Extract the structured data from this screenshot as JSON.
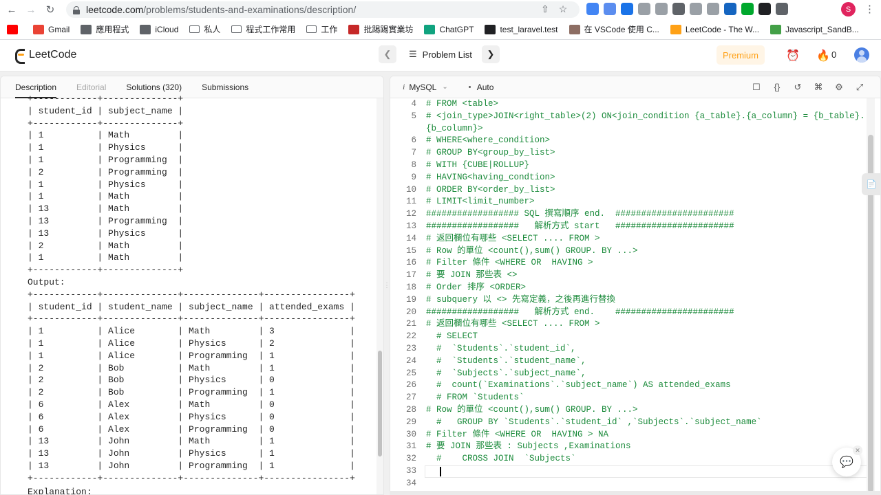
{
  "browser": {
    "url_host": "leetcode.com",
    "url_path": "/problems/students-and-examinations/description/",
    "profile_initial": "S",
    "extensions": [
      {
        "name": "extension-1",
        "color": "#4285f4"
      },
      {
        "name": "extension-2",
        "color": "#5b8def"
      },
      {
        "name": "translate",
        "color": "#1a73e8"
      },
      {
        "name": "extension-4",
        "color": "#9aa0a6"
      },
      {
        "name": "extension-5",
        "color": "#9aa0a6"
      },
      {
        "name": "extension-6",
        "color": "#5f6368"
      },
      {
        "name": "extension-7",
        "color": "#9aa0a6"
      },
      {
        "name": "extension-8",
        "color": "#9aa0a6"
      },
      {
        "name": "extension-9",
        "color": "#1565c0"
      },
      {
        "name": "evernote",
        "color": "#00a82d"
      },
      {
        "name": "chatgpt-ext",
        "color": "#202124"
      },
      {
        "name": "puzzle",
        "color": "#5f6368"
      }
    ],
    "bookmarks": [
      {
        "label": "",
        "icon": "youtube-icon",
        "color": "#ff0000"
      },
      {
        "label": "Gmail",
        "icon": "gmail-icon",
        "color": "#ea4335"
      },
      {
        "label": "應用程式",
        "icon": "apps-grid-icon",
        "color": "#5f6368"
      },
      {
        "label": "iCloud",
        "icon": "apple-icon",
        "color": "#5f6368"
      },
      {
        "label": "私人",
        "icon": "folder-icon",
        "color": ""
      },
      {
        "label": "程式工作常用",
        "icon": "folder-icon",
        "color": ""
      },
      {
        "label": "工作",
        "icon": "folder-icon",
        "color": ""
      },
      {
        "label": "批踢踢實業坊",
        "icon": "ptt-icon",
        "color": "#c62828"
      },
      {
        "label": "ChatGPT",
        "icon": "chatgpt-icon",
        "color": "#10a37f"
      },
      {
        "label": "test_laravel.test",
        "icon": "globe-icon",
        "color": "#202124"
      },
      {
        "label": "在 VSCode 使用 C...",
        "icon": "image-icon",
        "color": "#8d6e63"
      },
      {
        "label": "LeetCode - The W...",
        "icon": "leetcode-icon",
        "color": "#ffa116"
      },
      {
        "label": "Javascript_SandB...",
        "icon": "sandbox-icon",
        "color": "#43a047"
      }
    ]
  },
  "header": {
    "logo_text": "LeetCode",
    "problem_list_label": "Problem List",
    "premium_label": "Premium",
    "streak_count": "0"
  },
  "left_tabs": [
    {
      "label": "Description",
      "state": "active"
    },
    {
      "label": "Editorial",
      "state": "disabled"
    },
    {
      "label": "Solutions (320)",
      "state": "normal"
    },
    {
      "label": "Submissions",
      "state": "normal"
    }
  ],
  "description": {
    "examinations_table_lines": [
      "+------------+--------------+",
      "| student_id | subject_name |",
      "+------------+--------------+",
      "| 1          | Math         |",
      "| 1          | Physics      |",
      "| 1          | Programming  |",
      "| 2          | Programming  |",
      "| 1          | Physics      |",
      "| 1          | Math         |",
      "| 13         | Math         |",
      "| 13         | Programming  |",
      "| 13         | Physics      |",
      "| 2          | Math         |",
      "| 1          | Math         |",
      "+------------+--------------+"
    ],
    "output_label": "Output:",
    "output_table_lines": [
      "+------------+--------------+--------------+----------------+",
      "| student_id | student_name | subject_name | attended_exams |",
      "+------------+--------------+--------------+----------------+",
      "| 1          | Alice        | Math         | 3              |",
      "| 1          | Alice        | Physics      | 2              |",
      "| 1          | Alice        | Programming  | 1              |",
      "| 2          | Bob          | Math         | 1              |",
      "| 2          | Bob          | Physics      | 0              |",
      "| 2          | Bob          | Programming  | 1              |",
      "| 6          | Alex         | Math         | 0              |",
      "| 6          | Alex         | Physics      | 0              |",
      "| 6          | Alex         | Programming  | 0              |",
      "| 13         | John         | Math         | 1              |",
      "| 13         | John         | Physics      | 1              |",
      "| 13         | John         | Programming  | 1              |",
      "+------------+--------------+--------------+----------------+"
    ],
    "explanation_label": "Explanation:"
  },
  "editor": {
    "language": "MySQL",
    "mode": "Auto",
    "current_line": 33,
    "lines": [
      {
        "n": 4,
        "text": "# FROM <table>"
      },
      {
        "n": 5,
        "text": "# <join_type>JOIN<right_table>(2) ON<join_condition {a_table}.{a_column} = {b_table}."
      },
      {
        "n": "",
        "text": "{b_column}>"
      },
      {
        "n": 6,
        "text": "# WHERE<where_condition>"
      },
      {
        "n": 7,
        "text": "# GROUP BY<group_by_list>"
      },
      {
        "n": 8,
        "text": "# WITH {CUBE|ROLLUP}"
      },
      {
        "n": 9,
        "text": "# HAVING<having_condtion>"
      },
      {
        "n": 10,
        "text": "# ORDER BY<order_by_list>"
      },
      {
        "n": 11,
        "text": "# LIMIT<limit_number>"
      },
      {
        "n": 12,
        "text": "################## SQL 撰寫順序 end.  #######################"
      },
      {
        "n": 13,
        "text": "##################   解析方式 start   #######################"
      },
      {
        "n": 14,
        "text": "# 返回欄位有哪些 <SELECT .... FROM >"
      },
      {
        "n": 15,
        "text": "# Row 的單位 <count(),sum() GROUP. BY ...>"
      },
      {
        "n": 16,
        "text": "# Filter 條件 <WHERE OR  HAVING >"
      },
      {
        "n": 17,
        "text": "# 要 JOIN 那些表 <>"
      },
      {
        "n": 18,
        "text": "# Order 排序 <ORDER>"
      },
      {
        "n": 19,
        "text": "# subquery 以 <> 先寫定義，之後再進行替換"
      },
      {
        "n": 20,
        "text": "##################   解析方式 end.    #######################"
      },
      {
        "n": 21,
        "text": "# 返回欄位有哪些 <SELECT .... FROM >"
      },
      {
        "n": 22,
        "text": "  # SELECT"
      },
      {
        "n": 23,
        "text": "  #  `Students`.`student_id`,"
      },
      {
        "n": 24,
        "text": "  #  `Students`.`student_name`,"
      },
      {
        "n": 25,
        "text": "  #  `Subjects`.`subject_name`,"
      },
      {
        "n": 26,
        "text": "  #  count(`Examinations`.`subject_name`) AS attended_exams"
      },
      {
        "n": 27,
        "text": "  # FROM `Students`"
      },
      {
        "n": 28,
        "text": "# Row 的單位 <count(),sum() GROUP. BY ...>"
      },
      {
        "n": 29,
        "text": "  #   GROUP BY `Students`.`student_id` ,`Subjects`.`subject_name`"
      },
      {
        "n": 30,
        "text": "# Filter 條件 <WHERE OR  HAVING > NA"
      },
      {
        "n": 31,
        "text": "# 要 JOIN 那些表 : Subjects ,Examinations"
      },
      {
        "n": 32,
        "text": "  #    CROSS JOIN  `Subjects`"
      },
      {
        "n": 33,
        "text": ""
      },
      {
        "n": 34,
        "text": ""
      }
    ]
  },
  "colors": {
    "comment_green": "#1a8a3a",
    "accent_orange": "#ffa116",
    "premium_bg": "#fff5e6"
  }
}
